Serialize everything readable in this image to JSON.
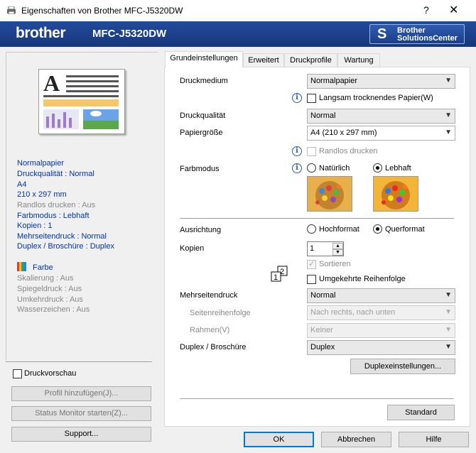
{
  "window": {
    "title": "Eigenschaften von Brother MFC-J5320DW",
    "help_label": "?",
    "close_label": "✕"
  },
  "banner": {
    "logo": "brother",
    "model": "MFC-J5320DW",
    "solutions_line1": "Brother",
    "solutions_line2": "SolutionsCenter"
  },
  "left": {
    "summary": [
      "Normalpapier",
      "Druckqualität : Normal",
      "A4",
      "210 x 297 mm",
      "Randlos drucken : Aus",
      "Farbmodus : Lebhaft",
      "Kopien : 1",
      "Mehrseitendruck : Normal",
      "Duplex / Broschüre : Duplex"
    ],
    "color_label": "Farbe",
    "extras": [
      "Skalierung : Aus",
      "Spiegeldruck : Aus",
      "Umkehrdruck : Aus",
      "Wasserzeichen : Aus"
    ],
    "print_preview": "Druckvorschau",
    "add_profile": "Profil hinzufügen(J)...",
    "status_monitor": "Status Monitor starten(Z)...",
    "support": "Support..."
  },
  "tabs": [
    "Grundeinstellungen",
    "Erweitert",
    "Druckprofile",
    "Wartung"
  ],
  "form": {
    "media_label": "Druckmedium",
    "media_value": "Normalpapier",
    "slow_dry": "Langsam trocknendes Papier(W)",
    "quality_label": "Druckqualität",
    "quality_value": "Normal",
    "paper_label": "Papiergröße",
    "paper_value": "A4 (210 x 297 mm)",
    "borderless": "Randlos drucken",
    "colormode_label": "Farbmodus",
    "natural": "Natürlich",
    "vivid": "Lebhaft",
    "orientation_label": "Ausrichtung",
    "portrait": "Hochformat",
    "landscape": "Querformat",
    "copies_label": "Kopien",
    "copies_value": "1",
    "collate": "Sortieren",
    "reverse": "Umgekehrte Reihenfolge",
    "multipage_label": "Mehrseitendruck",
    "multipage_value": "Normal",
    "page_order_label": "Seitenreihenfolge",
    "page_order_value": "Nach rechts, nach unten",
    "border_label": "Rahmen(V)",
    "border_value": "Keiner",
    "duplex_label": "Duplex / Broschüre",
    "duplex_value": "Duplex",
    "duplex_settings": "Duplexeinstellungen...",
    "default": "Standard"
  },
  "footer": {
    "ok": "OK",
    "cancel": "Abbrechen",
    "help": "Hilfe"
  },
  "colors": {
    "banner": "#1c3f8a",
    "link_text": "#0033aa",
    "accent": "#0078d7"
  }
}
